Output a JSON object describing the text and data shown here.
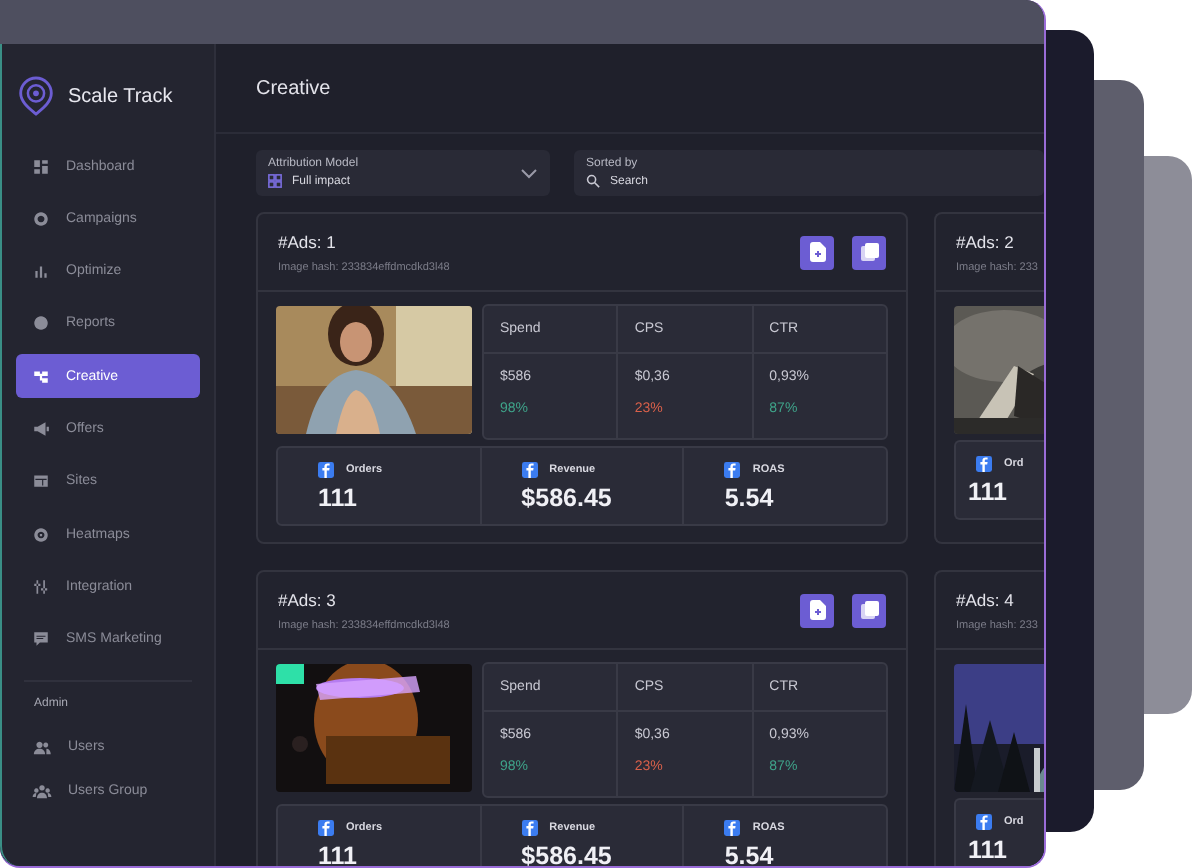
{
  "app": {
    "name": "Scale Track"
  },
  "sidebar": {
    "items": [
      {
        "label": "Dashboard",
        "selected": false
      },
      {
        "label": "Campaigns",
        "selected": false
      },
      {
        "label": "Optimize",
        "selected": false
      },
      {
        "label": "Reports",
        "selected": false
      },
      {
        "label": "Creative",
        "selected": true
      },
      {
        "label": "Offers",
        "selected": false
      },
      {
        "label": "Sites",
        "selected": false
      },
      {
        "label": "Heatmaps",
        "selected": false
      },
      {
        "label": "Integration",
        "selected": false
      },
      {
        "label": "SMS Marketing",
        "selected": false
      }
    ],
    "section": "Admin",
    "admin_items": [
      {
        "label": "Users",
        "selected": false
      },
      {
        "label": "Users Group",
        "selected": false
      }
    ]
  },
  "page_title": "Creative",
  "filters": [
    {
      "kind": "select",
      "label": "Attribution Model",
      "value": "Full impact"
    },
    {
      "kind": "search",
      "label": "Sorted by",
      "placeholder": "Search"
    }
  ],
  "ads": [
    {
      "kind": "full",
      "title": "#Ads: 1",
      "hash": "Image hash: 233834effdmcdkd3l48",
      "metrics": [
        {
          "label": "Spend",
          "value": "$586",
          "change": "98%",
          "color": "#3fa48a"
        },
        {
          "label": "CPS",
          "value": "$0,36",
          "change": "23%",
          "color": "#d8604a"
        },
        {
          "label": "CTR",
          "value": "0,93%",
          "change": "87%",
          "color": "#3fa48a"
        }
      ],
      "stats": [
        {
          "label": "Orders",
          "value": "111"
        },
        {
          "label": "Revenue",
          "value": "$586.45"
        },
        {
          "label": "ROAS",
          "value": "5.54"
        }
      ]
    },
    {
      "kind": "partial",
      "title": "#Ads: 2",
      "hash": "Image hash: 233",
      "stats": [
        {
          "label": "Ord",
          "value": "111"
        }
      ]
    },
    {
      "kind": "full",
      "title": "#Ads: 3",
      "hash": "Image hash: 233834effdmcdkd3l48",
      "metrics": [
        {
          "label": "Spend",
          "value": "$586",
          "change": "98%",
          "color": "#3fa48a"
        },
        {
          "label": "CPS",
          "value": "$0,36",
          "change": "23%",
          "color": "#d8604a"
        },
        {
          "label": "CTR",
          "value": "0,93%",
          "change": "87%",
          "color": "#3fa48a"
        }
      ],
      "stats": [
        {
          "label": "Orders",
          "value": "111"
        },
        {
          "label": "Revenue",
          "value": "$586.45"
        },
        {
          "label": "ROAS",
          "value": "5.54"
        }
      ]
    },
    {
      "kind": "partial",
      "title": "#Ads: 4",
      "hash": "Image hash: 233",
      "stats": [
        {
          "label": "Ord",
          "value": "111"
        }
      ]
    }
  ]
}
